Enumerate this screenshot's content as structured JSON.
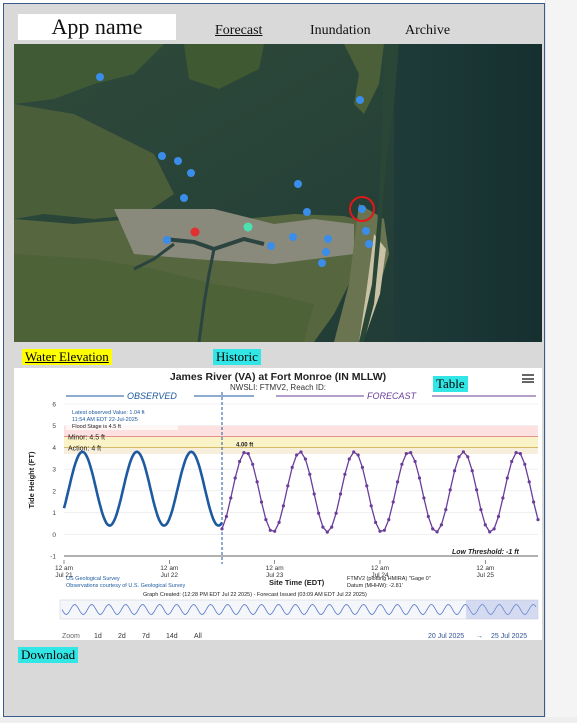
{
  "header": {
    "app_name": "App name",
    "nav": [
      "Forecast",
      "Inundation",
      "Archive"
    ]
  },
  "tags": {
    "water_elevation": "Water Elevation",
    "historic": "Historic",
    "table": "Table",
    "download": "Download"
  },
  "colors": {
    "observed": "#1e5aa0",
    "forecast": "#6a3d9a",
    "minor_band": "#fde0e0",
    "action_band": "#fbf3c8",
    "highlight_yellow": "#ffff00",
    "highlight_cyan": "#33e6e6"
  },
  "map": {
    "markers_icon": "map-pin-icon",
    "selected_marker_icon": "selected-pin-icon"
  },
  "chart": {
    "title": "James River (VA) at Fort Monroe (IN MLLW)",
    "subtitle": "NWSLI: FTMV2, Reach ID:",
    "observed_label": "OBSERVED",
    "forecast_label": "FORECAST",
    "latest_line1": "Latest observed Value: 1.04 ft",
    "latest_line2": "11:54 AM EDT 22-Jul-2025",
    "flood_stage": "Flood Stage is 4.5 ft",
    "minor_label": "Minor: 4.5 ft",
    "action_label": "Action: 4 ft",
    "peak_label": "4.00 ft",
    "low_threshold": "Low Threshold: -1 ft",
    "ylabel": "Tide Height (FT)",
    "xlabel": "Site Time (EDT)",
    "xticks": [
      {
        "top": "12 am",
        "bottom": "Jul 21"
      },
      {
        "top": "12 am",
        "bottom": "Jul 22"
      },
      {
        "top": "12 am",
        "bottom": "Jul 23"
      },
      {
        "top": "12 am",
        "bottom": "Jul 24"
      },
      {
        "top": "12 am",
        "bottom": "Jul 25"
      }
    ],
    "credit1": "US Geological Survey",
    "credit2": "Observations courtesy of U.S. Geological Survey",
    "ftm_line1": "FTMV2 (plotting HMIRA) \"Gage 0\"",
    "ftm_line2": "Datum (MHHW): -2.81'",
    "created": "Graph Created: (12:28 PM EDT Jul 22 2025) - Forecast Issued (03:09 AM EDT Jul 22 2025)",
    "zoom": [
      "Zoom",
      "1d",
      "2d",
      "7d",
      "14d",
      "All"
    ],
    "range_from": "20 Jul 2025",
    "range_arrow": "→",
    "range_to": "25 Jul 2025"
  },
  "chart_data": {
    "type": "line",
    "title": "James River (VA) at Fort Monroe (IN MLLW)",
    "xlabel": "Site Time (EDT)",
    "ylabel": "Tide Height (FT)",
    "xlim": [
      "2025-07-21 00:00",
      "2025-07-25 12:00"
    ],
    "ylim": [
      -1,
      6
    ],
    "yticks": [
      -1,
      0,
      1,
      2,
      3,
      4,
      5,
      6
    ],
    "thresholds": {
      "minor": 4.5,
      "action": 4,
      "low": -1
    },
    "series": [
      {
        "name": "OBSERVED",
        "t0": "2025-07-21 00:00",
        "t1": "2025-07-22 12:00",
        "mean": 2.1,
        "amplitude": 1.7,
        "period_hours": 12.4
      },
      {
        "name": "FORECAST",
        "t0": "2025-07-22 12:00",
        "t1": "2025-07-25 12:00",
        "mean": 1.95,
        "amplitude": 1.85,
        "period_hours": 12.4
      }
    ]
  }
}
